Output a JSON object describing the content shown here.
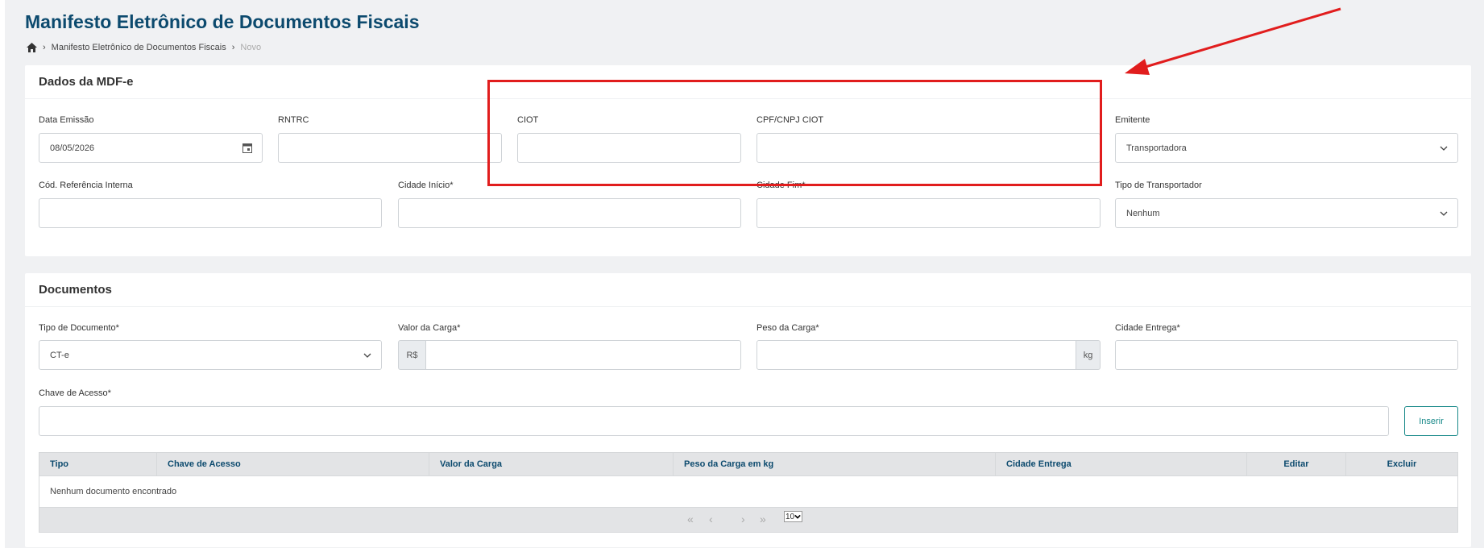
{
  "page": {
    "title": "Manifesto Eletrônico de Documentos Fiscais",
    "breadcrumb": {
      "item1": "Manifesto Eletrônico de Documentos Fiscais",
      "current": "Novo"
    }
  },
  "dados": {
    "title": "Dados da MDF-e",
    "data_emissao": {
      "label": "Data Emissão",
      "value": "08/05/2026"
    },
    "rntrc": {
      "label": "RNTRC",
      "value": ""
    },
    "ciot": {
      "label": "CIOT",
      "value": ""
    },
    "cpf_cnpj_ciot": {
      "label": "CPF/CNPJ CIOT",
      "value": ""
    },
    "emitente": {
      "label": "Emitente",
      "value": "Transportadora"
    },
    "cod_ref": {
      "label": "Cód. Referência Interna",
      "value": ""
    },
    "cidade_inicio": {
      "label": "Cidade Início*",
      "value": ""
    },
    "cidade_fim": {
      "label": "Cidade Fim*",
      "value": ""
    },
    "tipo_transportador": {
      "label": "Tipo de Transportador",
      "value": "Nenhum"
    }
  },
  "documentos": {
    "title": "Documentos",
    "tipo_documento": {
      "label": "Tipo de Documento*",
      "value": "CT-e"
    },
    "valor_carga": {
      "label": "Valor da Carga*",
      "prefix": "R$",
      "value": ""
    },
    "peso_carga": {
      "label": "Peso da Carga*",
      "suffix": "kg",
      "value": ""
    },
    "cidade_entrega": {
      "label": "Cidade Entrega*",
      "value": ""
    },
    "chave_acesso": {
      "label": "Chave de Acesso*",
      "value": ""
    },
    "inserir_label": "Inserir",
    "table": {
      "columns": [
        "Tipo",
        "Chave de Acesso",
        "Valor da Carga",
        "Peso da Carga em kg",
        "Cidade Entrega",
        "Editar",
        "Excluir"
      ],
      "empty_text": "Nenhum documento encontrado",
      "pagination": {
        "first": "«",
        "prev": "‹",
        "next": "›",
        "last": "»",
        "page_size": "10"
      }
    }
  },
  "colors": {
    "title": "#0c4a6e",
    "accent": "#1a8a8a",
    "annotation": "#e11d1d"
  }
}
